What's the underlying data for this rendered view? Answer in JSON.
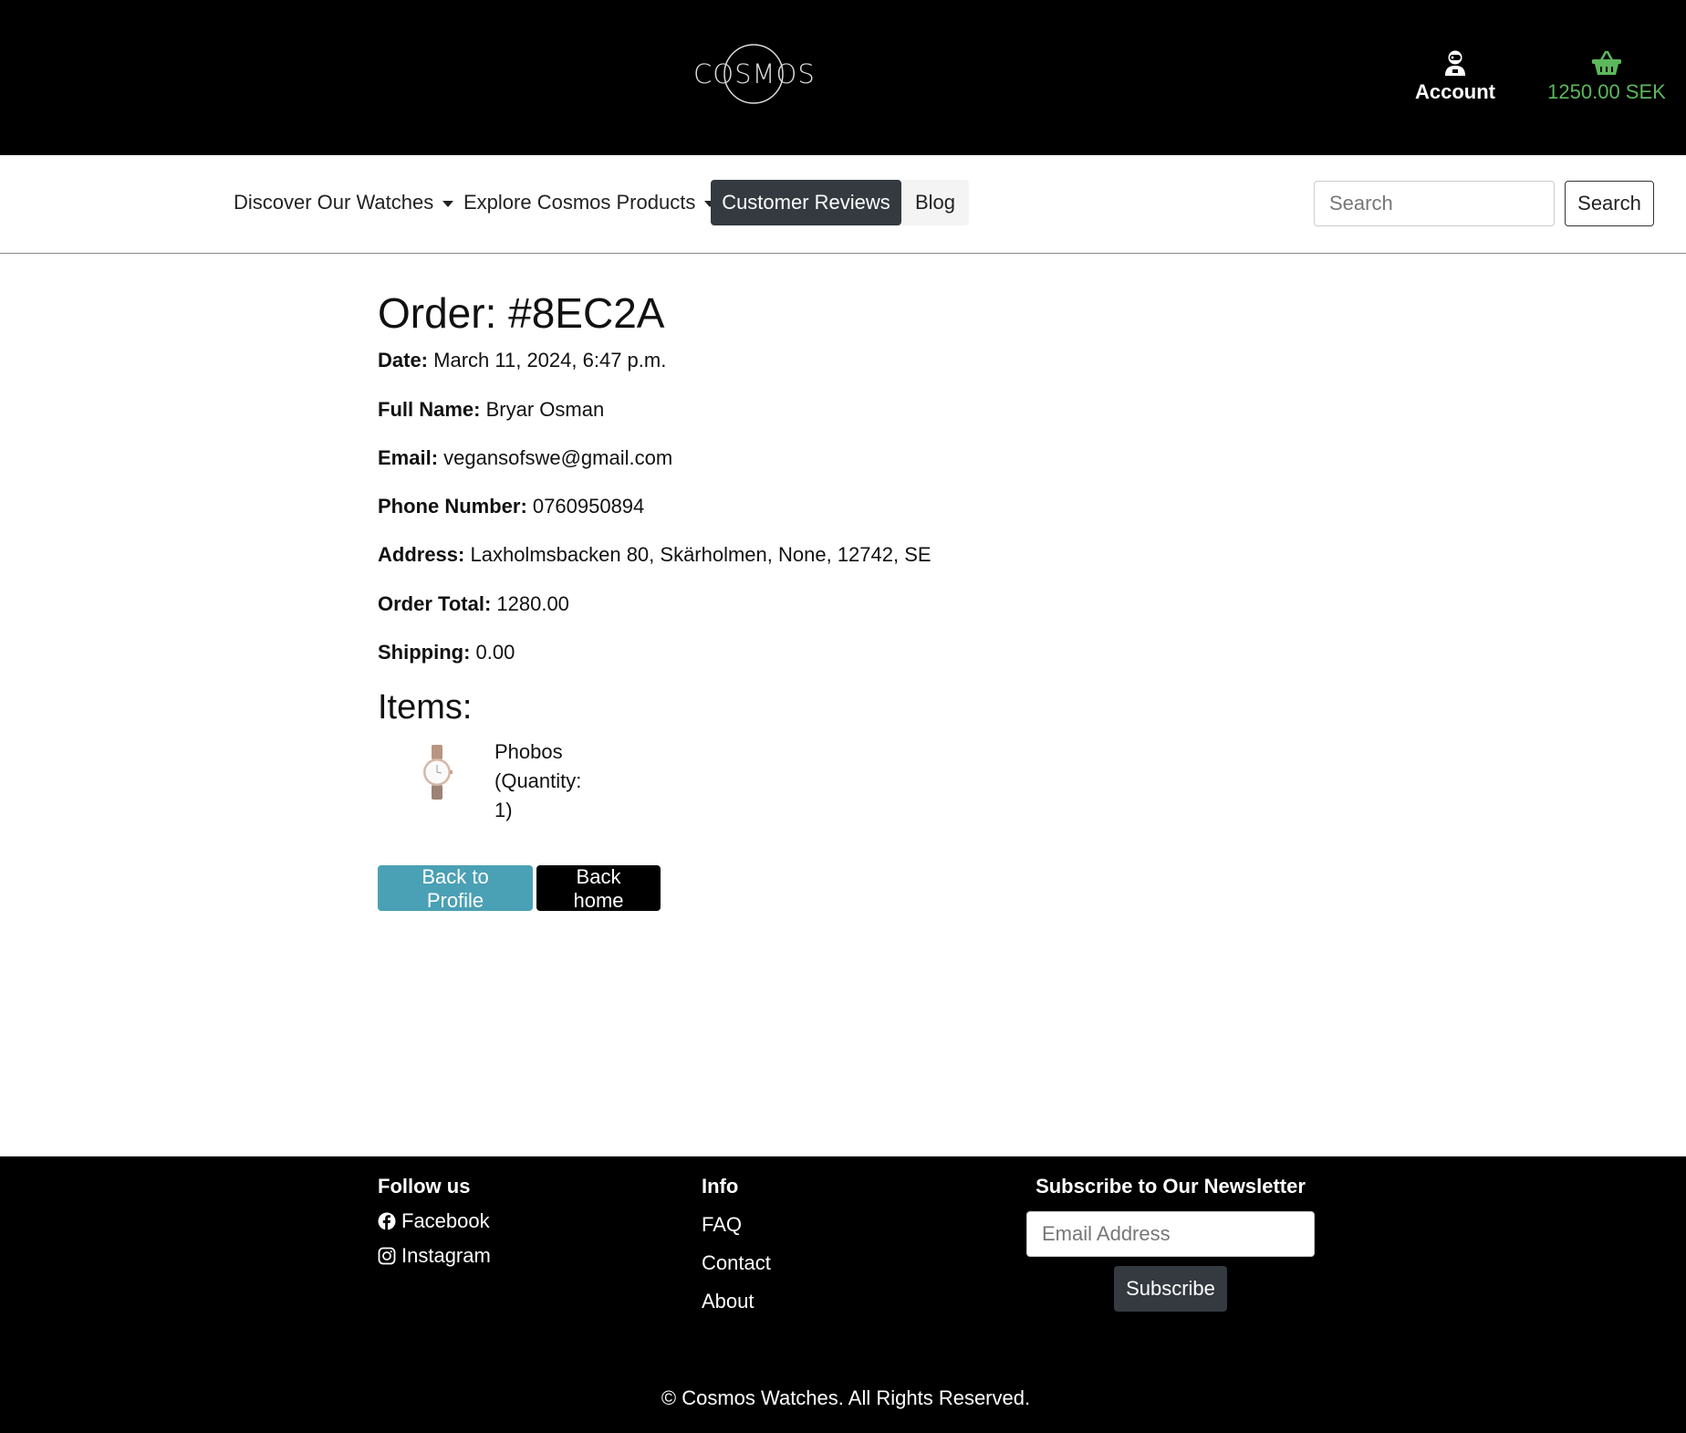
{
  "header": {
    "logo_text": "COSMOS",
    "account_label": "Account",
    "cart_total": "1250.00 SEK",
    "account_icon": "user-icon",
    "cart_icon": "basket-icon",
    "cart_color": "#5cb85c"
  },
  "nav": {
    "items": [
      {
        "label": "Discover Our Watches",
        "dropdown": true
      },
      {
        "label": "Explore Cosmos Products",
        "dropdown": true
      },
      {
        "label": "Customer Reviews",
        "active": true
      },
      {
        "label": "Blog"
      }
    ],
    "search_placeholder": "Search",
    "search_button": "Search"
  },
  "order": {
    "title": "Order: #8EC2A",
    "fields": [
      {
        "label": "Date:",
        "value": "March 11, 2024, 6:47 p.m."
      },
      {
        "label": "Full Name:",
        "value": "Bryar Osman"
      },
      {
        "label": "Email:",
        "value": "vegansofswe@gmail.com"
      },
      {
        "label": "Phone Number:",
        "value": "0760950894"
      },
      {
        "label": "Address:",
        "value": "Laxholmsbacken 80, Skärholmen, None, 12742, SE"
      },
      {
        "label": "Order Total:",
        "value": "1280.00"
      },
      {
        "label": "Shipping:",
        "value": "0.00"
      }
    ],
    "items_heading": "Items:",
    "items": [
      {
        "name": "Phobos (Quantity: 1)"
      }
    ],
    "back_profile_label": "Back to Profile",
    "back_home_label": "Back home",
    "back_profile_color": "#4aa0b5"
  },
  "footer": {
    "follow_heading": "Follow us",
    "social": [
      {
        "label": "Facebook",
        "icon": "facebook-icon"
      },
      {
        "label": "Instagram",
        "icon": "instagram-icon"
      }
    ],
    "info_heading": "Info",
    "info_links": [
      "FAQ",
      "Contact",
      "About"
    ],
    "newsletter_heading": "Subscribe to Our Newsletter",
    "newsletter_placeholder": "Email Address",
    "subscribe_label": "Subscribe",
    "copyright": "© Cosmos Watches. All Rights Reserved."
  }
}
